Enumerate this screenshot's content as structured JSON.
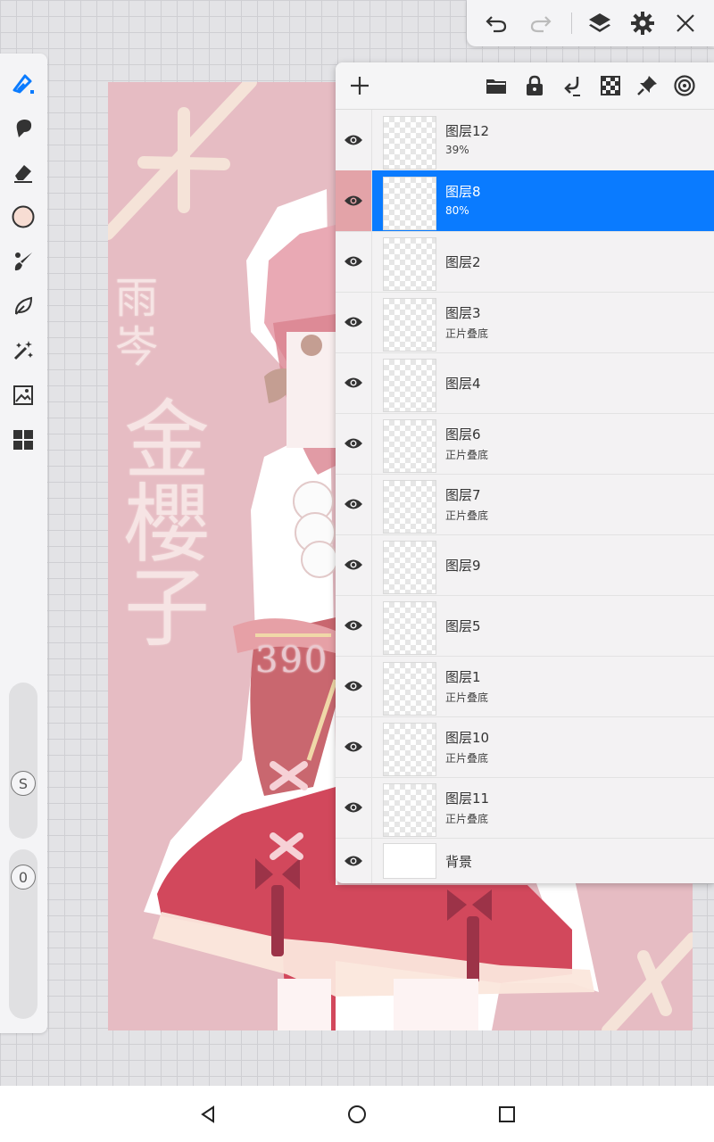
{
  "artwork": {
    "name_line1": "雨岑",
    "name_line2": "金櫻子",
    "id_text": "390",
    "colors": {
      "background": "#e6bcc3",
      "dress": "#d2485c",
      "outline": "#ffffff"
    }
  },
  "left_toolbar": {
    "tools": [
      {
        "name": "brush",
        "icon": "pen-icon",
        "active": true
      },
      {
        "name": "smudge",
        "icon": "smudge-icon"
      },
      {
        "name": "eraser",
        "icon": "eraser-icon"
      },
      {
        "name": "color",
        "icon": "color-swatch",
        "color": "#f7ddd3"
      },
      {
        "name": "brush-settings",
        "icon": "brush-settings-icon"
      },
      {
        "name": "lasso",
        "icon": "lasso-icon"
      },
      {
        "name": "magic-wand",
        "icon": "magic-wand-icon"
      },
      {
        "name": "image-adjust",
        "icon": "image-adjust-icon"
      },
      {
        "name": "more-tools",
        "icon": "grid-icon"
      }
    ],
    "size_label": "S",
    "opacity_label": "0"
  },
  "top_toolbar": {
    "buttons": [
      "undo-icon",
      "redo-icon",
      "layers-icon",
      "gear-icon",
      "close-icon"
    ]
  },
  "layers_panel": {
    "header_buttons": [
      "add-icon",
      "folder-icon",
      "lock-icon",
      "merge-down-icon",
      "checker-icon",
      "pin-icon",
      "target-icon"
    ],
    "layers": [
      {
        "name": "图层12",
        "sub": "39%"
      },
      {
        "name": "图层8",
        "sub": "80%",
        "selected": true
      },
      {
        "name": "图层2",
        "sub": ""
      },
      {
        "name": "图层3",
        "sub": "正片叠底"
      },
      {
        "name": "图层4",
        "sub": ""
      },
      {
        "name": "图层6",
        "sub": "正片叠底"
      },
      {
        "name": "图层7",
        "sub": "正片叠底"
      },
      {
        "name": "图层9",
        "sub": ""
      },
      {
        "name": "图层5",
        "sub": ""
      },
      {
        "name": "图层1",
        "sub": "正片叠底"
      },
      {
        "name": "图层10",
        "sub": "正片叠底"
      },
      {
        "name": "图层11",
        "sub": "正片叠底"
      },
      {
        "name": "背景",
        "sub": ""
      }
    ],
    "selection_color": "#0a7bff"
  },
  "nav_bar": {
    "buttons": [
      "back-icon",
      "home-icon",
      "recents-icon"
    ]
  }
}
